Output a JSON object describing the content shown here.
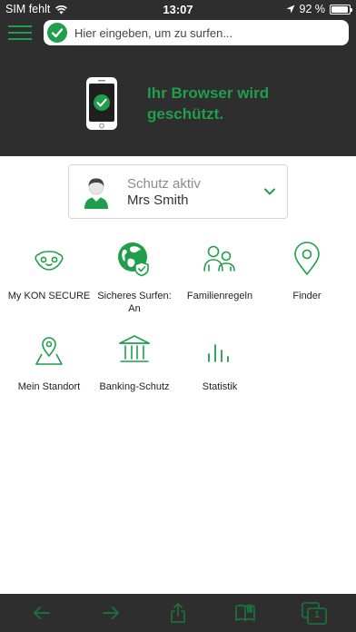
{
  "status_bar": {
    "carrier": "SIM fehlt",
    "time": "13:07",
    "battery": "92 %",
    "battery_level": 0.92
  },
  "browser": {
    "url_placeholder": "Hier eingeben, um zu surfen..."
  },
  "hero": {
    "message": "Ihr Browser wird geschützt."
  },
  "profile": {
    "status": "Schutz aktiv",
    "name": "Mrs Smith"
  },
  "features": [
    {
      "label": "My KON SECURE",
      "icon": "shield-face-icon"
    },
    {
      "label": "Sicheres Surfen: An",
      "icon": "globe-shield-icon"
    },
    {
      "label": "Familienregeln",
      "icon": "family-icon"
    },
    {
      "label": "Finder",
      "icon": "location-pin-icon"
    },
    {
      "label": "Mein Standort",
      "icon": "map-pin-icon"
    },
    {
      "label": "Banking-Schutz",
      "icon": "bank-icon"
    },
    {
      "label": "Statistik",
      "icon": "bar-chart-icon"
    }
  ],
  "toolbar": {
    "tabs_count": "1",
    "items": [
      "back-arrow-icon",
      "forward-arrow-icon",
      "share-icon",
      "bookmarks-icon",
      "tabs-icon"
    ]
  },
  "colors": {
    "accent": "#1f9e4c",
    "header_bg": "#2e2e2e",
    "toolbar_icon_disabled": "#1d6e3a"
  }
}
